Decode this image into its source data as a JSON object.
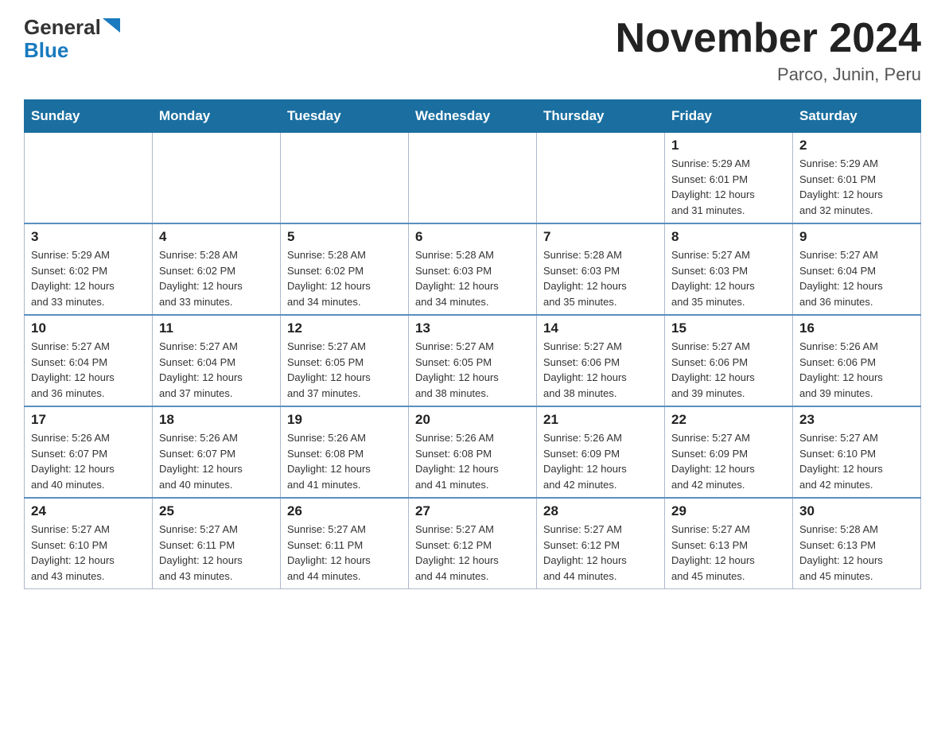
{
  "header": {
    "logo_general": "General",
    "logo_blue": "Blue",
    "month_title": "November 2024",
    "location": "Parco, Junin, Peru"
  },
  "days_of_week": [
    "Sunday",
    "Monday",
    "Tuesday",
    "Wednesday",
    "Thursday",
    "Friday",
    "Saturday"
  ],
  "weeks": [
    [
      {
        "day": "",
        "info": ""
      },
      {
        "day": "",
        "info": ""
      },
      {
        "day": "",
        "info": ""
      },
      {
        "day": "",
        "info": ""
      },
      {
        "day": "",
        "info": ""
      },
      {
        "day": "1",
        "info": "Sunrise: 5:29 AM\nSunset: 6:01 PM\nDaylight: 12 hours\nand 31 minutes."
      },
      {
        "day": "2",
        "info": "Sunrise: 5:29 AM\nSunset: 6:01 PM\nDaylight: 12 hours\nand 32 minutes."
      }
    ],
    [
      {
        "day": "3",
        "info": "Sunrise: 5:29 AM\nSunset: 6:02 PM\nDaylight: 12 hours\nand 33 minutes."
      },
      {
        "day": "4",
        "info": "Sunrise: 5:28 AM\nSunset: 6:02 PM\nDaylight: 12 hours\nand 33 minutes."
      },
      {
        "day": "5",
        "info": "Sunrise: 5:28 AM\nSunset: 6:02 PM\nDaylight: 12 hours\nand 34 minutes."
      },
      {
        "day": "6",
        "info": "Sunrise: 5:28 AM\nSunset: 6:03 PM\nDaylight: 12 hours\nand 34 minutes."
      },
      {
        "day": "7",
        "info": "Sunrise: 5:28 AM\nSunset: 6:03 PM\nDaylight: 12 hours\nand 35 minutes."
      },
      {
        "day": "8",
        "info": "Sunrise: 5:27 AM\nSunset: 6:03 PM\nDaylight: 12 hours\nand 35 minutes."
      },
      {
        "day": "9",
        "info": "Sunrise: 5:27 AM\nSunset: 6:04 PM\nDaylight: 12 hours\nand 36 minutes."
      }
    ],
    [
      {
        "day": "10",
        "info": "Sunrise: 5:27 AM\nSunset: 6:04 PM\nDaylight: 12 hours\nand 36 minutes."
      },
      {
        "day": "11",
        "info": "Sunrise: 5:27 AM\nSunset: 6:04 PM\nDaylight: 12 hours\nand 37 minutes."
      },
      {
        "day": "12",
        "info": "Sunrise: 5:27 AM\nSunset: 6:05 PM\nDaylight: 12 hours\nand 37 minutes."
      },
      {
        "day": "13",
        "info": "Sunrise: 5:27 AM\nSunset: 6:05 PM\nDaylight: 12 hours\nand 38 minutes."
      },
      {
        "day": "14",
        "info": "Sunrise: 5:27 AM\nSunset: 6:06 PM\nDaylight: 12 hours\nand 38 minutes."
      },
      {
        "day": "15",
        "info": "Sunrise: 5:27 AM\nSunset: 6:06 PM\nDaylight: 12 hours\nand 39 minutes."
      },
      {
        "day": "16",
        "info": "Sunrise: 5:26 AM\nSunset: 6:06 PM\nDaylight: 12 hours\nand 39 minutes."
      }
    ],
    [
      {
        "day": "17",
        "info": "Sunrise: 5:26 AM\nSunset: 6:07 PM\nDaylight: 12 hours\nand 40 minutes."
      },
      {
        "day": "18",
        "info": "Sunrise: 5:26 AM\nSunset: 6:07 PM\nDaylight: 12 hours\nand 40 minutes."
      },
      {
        "day": "19",
        "info": "Sunrise: 5:26 AM\nSunset: 6:08 PM\nDaylight: 12 hours\nand 41 minutes."
      },
      {
        "day": "20",
        "info": "Sunrise: 5:26 AM\nSunset: 6:08 PM\nDaylight: 12 hours\nand 41 minutes."
      },
      {
        "day": "21",
        "info": "Sunrise: 5:26 AM\nSunset: 6:09 PM\nDaylight: 12 hours\nand 42 minutes."
      },
      {
        "day": "22",
        "info": "Sunrise: 5:27 AM\nSunset: 6:09 PM\nDaylight: 12 hours\nand 42 minutes."
      },
      {
        "day": "23",
        "info": "Sunrise: 5:27 AM\nSunset: 6:10 PM\nDaylight: 12 hours\nand 42 minutes."
      }
    ],
    [
      {
        "day": "24",
        "info": "Sunrise: 5:27 AM\nSunset: 6:10 PM\nDaylight: 12 hours\nand 43 minutes."
      },
      {
        "day": "25",
        "info": "Sunrise: 5:27 AM\nSunset: 6:11 PM\nDaylight: 12 hours\nand 43 minutes."
      },
      {
        "day": "26",
        "info": "Sunrise: 5:27 AM\nSunset: 6:11 PM\nDaylight: 12 hours\nand 44 minutes."
      },
      {
        "day": "27",
        "info": "Sunrise: 5:27 AM\nSunset: 6:12 PM\nDaylight: 12 hours\nand 44 minutes."
      },
      {
        "day": "28",
        "info": "Sunrise: 5:27 AM\nSunset: 6:12 PM\nDaylight: 12 hours\nand 44 minutes."
      },
      {
        "day": "29",
        "info": "Sunrise: 5:27 AM\nSunset: 6:13 PM\nDaylight: 12 hours\nand 45 minutes."
      },
      {
        "day": "30",
        "info": "Sunrise: 5:28 AM\nSunset: 6:13 PM\nDaylight: 12 hours\nand 45 minutes."
      }
    ]
  ]
}
